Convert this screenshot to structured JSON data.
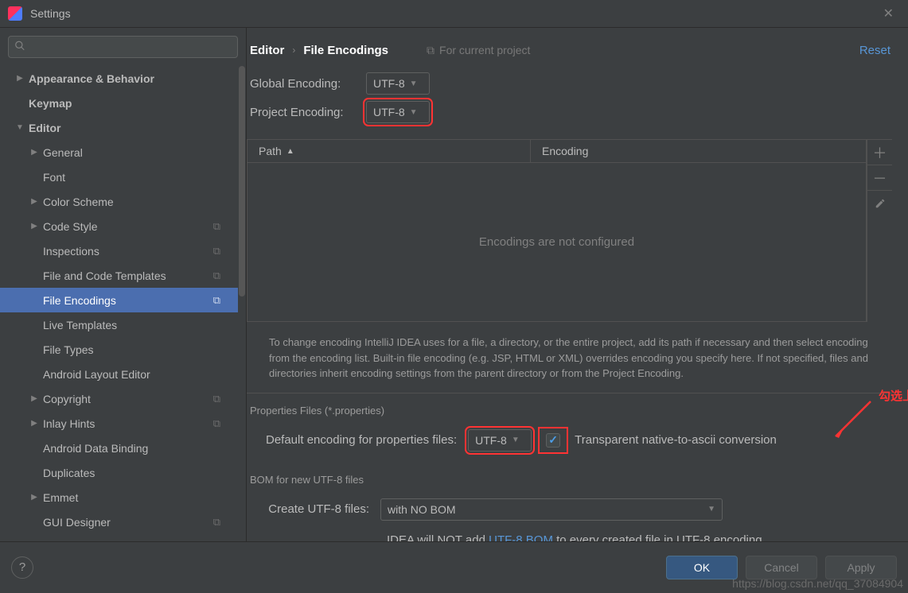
{
  "window": {
    "title": "Settings"
  },
  "sidebar": {
    "search_placeholder": "",
    "items": [
      {
        "label": "Appearance & Behavior",
        "arrow": "▶",
        "bold": true,
        "depth": 0
      },
      {
        "label": "Keymap",
        "arrow": "",
        "bold": true,
        "depth": 0
      },
      {
        "label": "Editor",
        "arrow": "▼",
        "bold": true,
        "depth": 0
      },
      {
        "label": "General",
        "arrow": "▶",
        "bold": false,
        "depth": 1
      },
      {
        "label": "Font",
        "arrow": "",
        "bold": false,
        "depth": 1
      },
      {
        "label": "Color Scheme",
        "arrow": "▶",
        "bold": false,
        "depth": 1
      },
      {
        "label": "Code Style",
        "arrow": "▶",
        "bold": false,
        "depth": 1,
        "copy": true
      },
      {
        "label": "Inspections",
        "arrow": "",
        "bold": false,
        "depth": 1,
        "copy": true
      },
      {
        "label": "File and Code Templates",
        "arrow": "",
        "bold": false,
        "depth": 1,
        "copy": true
      },
      {
        "label": "File Encodings",
        "arrow": "",
        "bold": false,
        "depth": 1,
        "copy": true,
        "selected": true
      },
      {
        "label": "Live Templates",
        "arrow": "",
        "bold": false,
        "depth": 1
      },
      {
        "label": "File Types",
        "arrow": "",
        "bold": false,
        "depth": 1
      },
      {
        "label": "Android Layout Editor",
        "arrow": "",
        "bold": false,
        "depth": 1
      },
      {
        "label": "Copyright",
        "arrow": "▶",
        "bold": false,
        "depth": 1,
        "copy": true
      },
      {
        "label": "Inlay Hints",
        "arrow": "▶",
        "bold": false,
        "depth": 1,
        "copy": true
      },
      {
        "label": "Android Data Binding",
        "arrow": "",
        "bold": false,
        "depth": 1
      },
      {
        "label": "Duplicates",
        "arrow": "",
        "bold": false,
        "depth": 1
      },
      {
        "label": "Emmet",
        "arrow": "▶",
        "bold": false,
        "depth": 1
      },
      {
        "label": "GUI Designer",
        "arrow": "",
        "bold": false,
        "depth": 1,
        "copy": true
      }
    ]
  },
  "breadcrumb": {
    "root": "Editor",
    "leaf": "File Encodings",
    "badge": "For current project",
    "reset": "Reset"
  },
  "encodings": {
    "global_label": "Global Encoding:",
    "global_value": "UTF-8",
    "project_label": "Project Encoding:",
    "project_value": "UTF-8"
  },
  "table": {
    "col_path": "Path",
    "col_enc": "Encoding",
    "empty": "Encodings are not configured"
  },
  "description": "To change encoding IntelliJ IDEA uses for a file, a directory, or the entire project, add its path if necessary and then select encoding from the encoding list. Built-in file encoding (e.g. JSP, HTML or XML) overrides encoding you specify here. If not specified, files and directories inherit encoding settings from the parent directory or from the Project Encoding.",
  "annotation": {
    "text": "勾选上"
  },
  "properties": {
    "section": "Properties Files (*.properties)",
    "default_label": "Default encoding for properties files:",
    "default_value": "UTF-8",
    "checkbox_label": "Transparent native-to-ascii conversion"
  },
  "bom": {
    "section": "BOM for new UTF-8 files",
    "create_label": "Create UTF-8 files:",
    "create_value": "with NO BOM",
    "note_pre": "IDEA will NOT add ",
    "note_link": "UTF-8 BOM",
    "note_post": " to every created file in UTF-8 encoding"
  },
  "footer": {
    "ok": "OK",
    "cancel": "Cancel",
    "apply": "Apply"
  },
  "watermark": "https://blog.csdn.net/qq_37084904"
}
